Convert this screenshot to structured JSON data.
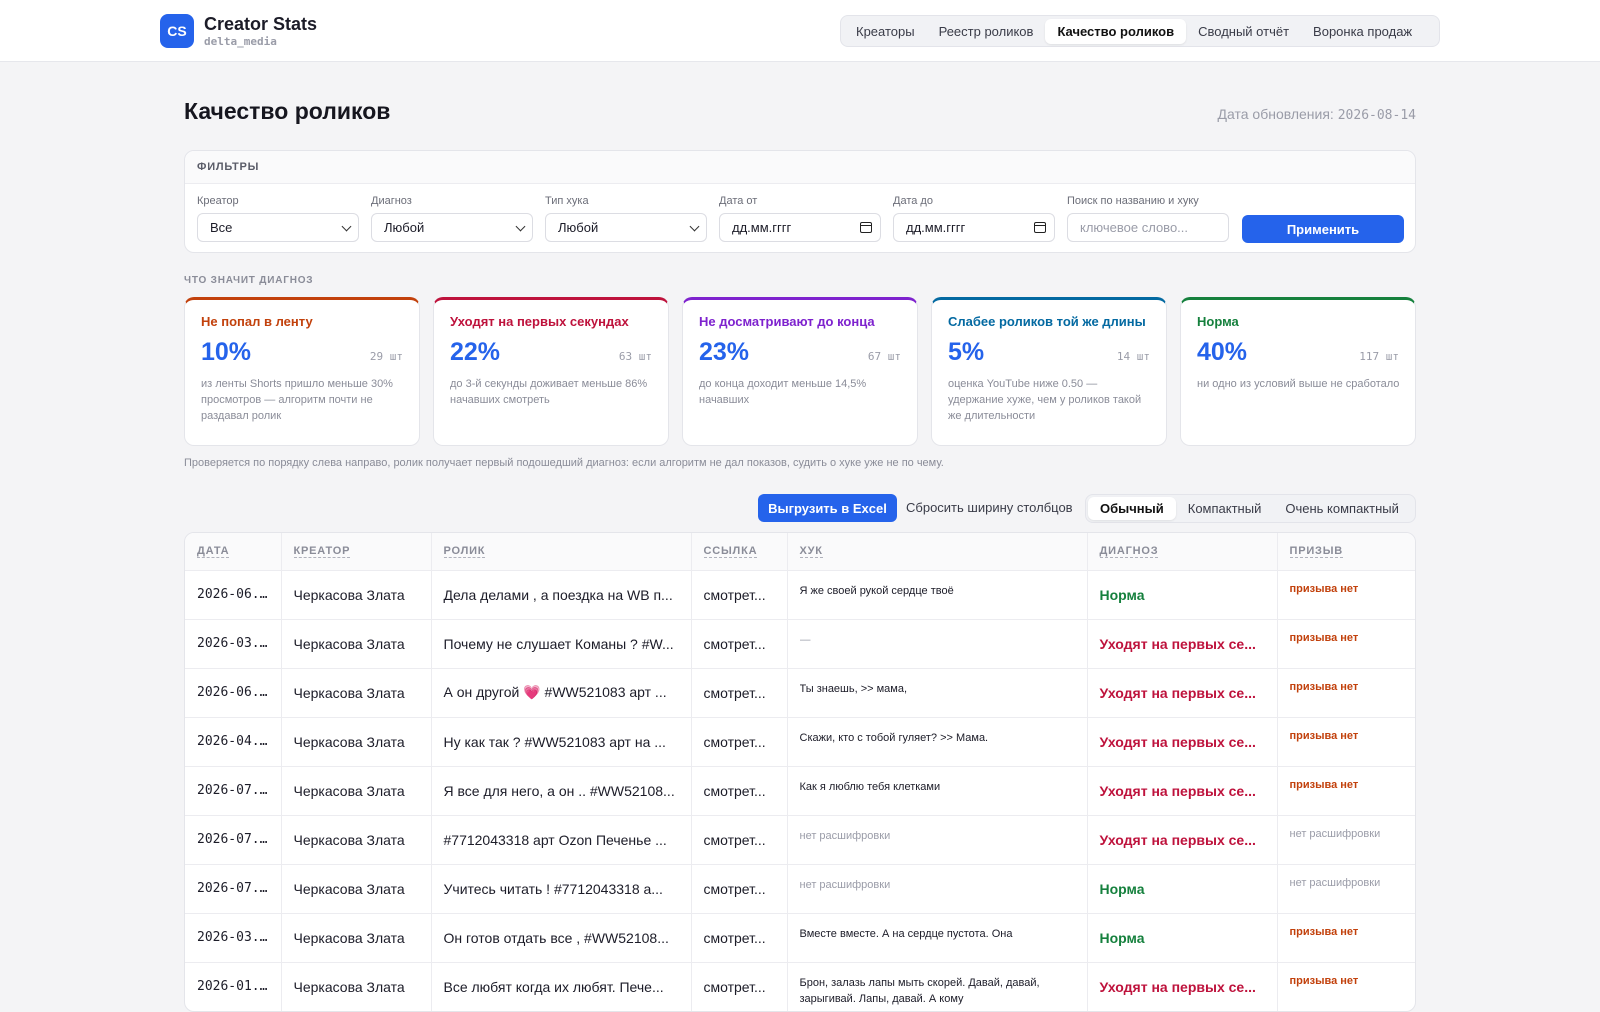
{
  "brand": {
    "logo": "CS",
    "title": "Creator Stats",
    "subtitle": "delta_media"
  },
  "nav": [
    "Креаторы",
    "Реестр роликов",
    "Качество роликов",
    "Сводный отчёт",
    "Воронка продаж"
  ],
  "nav_active": 2,
  "page": {
    "title": "Качество роликов",
    "update_label": "Дата обновления:",
    "update_date": "2026-08-14"
  },
  "filters": {
    "header": "ФИЛЬТРЫ",
    "creator": {
      "label": "Креатор",
      "value": "Все"
    },
    "diagnosis": {
      "label": "Диагноз",
      "value": "Любой"
    },
    "hook_type": {
      "label": "Тип хука",
      "value": "Любой"
    },
    "date_from": {
      "label": "Дата от",
      "value": "дд.мм.гггг"
    },
    "date_to": {
      "label": "Дата до",
      "value": "дд.мм.гггг"
    },
    "search": {
      "label": "Поиск по названию и хуку",
      "placeholder": "ключевое слово..."
    },
    "apply": "Применить"
  },
  "diagnosis_section": {
    "header": "ЧТО ЗНАЧИТ ДИАГНОЗ",
    "note": "Проверяется по порядку слева направо, ролик получает первый подошедший диагноз: если алгоритм не дал показов, судить о хуке уже не по чему.",
    "cards": [
      {
        "title": "Не попал в ленту",
        "percent": "10%",
        "count": "29 шт",
        "description": "из ленты Shorts пришло меньше 30% просмотров — алгоритм почти не раздавал ролик",
        "color": "#c2410c"
      },
      {
        "title": "Уходят на первых секундах",
        "percent": "22%",
        "count": "63 шт",
        "description": "до 3-й секунды доживает меньше 86% начавших смотреть",
        "color": "#be123c"
      },
      {
        "title": "Не досматривают до конца",
        "percent": "23%",
        "count": "67 шт",
        "description": "до конца доходит меньше 14,5% начавших",
        "color": "#7e22ce"
      },
      {
        "title": "Слабее роликов той же длины",
        "percent": "5%",
        "count": "14 шт",
        "description": "оценка YouTube ниже 0.50 — удержание хуже, чем у роликов такой же длительности",
        "color": "#0369a1"
      },
      {
        "title": "Норма",
        "percent": "40%",
        "count": "117 шт",
        "description": "ни одно из условий выше не сработало",
        "color": "#15803d"
      }
    ]
  },
  "toolbar": {
    "export": "Выгрузить в Excel",
    "reset": "Сбросить ширину столбцов",
    "density": [
      "Обычный",
      "Компактный",
      "Очень компактный"
    ],
    "density_active": 0
  },
  "table": {
    "columns": [
      "ДАТА",
      "КРЕАТОР",
      "РОЛИК",
      "ССЫЛКА",
      "ХУК",
      "ДИАГНОЗ",
      "ПРИЗЫВ"
    ],
    "rows": [
      {
        "date": "2026-06...",
        "creator": "Черкасова Злата",
        "video": "Дела делами , а поездка на WB п...",
        "link": "смотрет...",
        "hook": "Я же своей рукой сердце твоё",
        "diag": "Норма",
        "diag_color": "#15803d",
        "cta": "призыва нет",
        "hook_muted": false,
        "cta_muted": false
      },
      {
        "date": "2026-03...",
        "creator": "Черкасова Злата",
        "video": "Почему не слушает Команы ? #W...",
        "link": "смотрет...",
        "hook": "—",
        "diag": "Уходят на первых се...",
        "diag_color": "#be123c",
        "cta": "призыва нет",
        "hook_muted": true,
        "cta_muted": false
      },
      {
        "date": "2026-06...",
        "creator": "Черкасова Злата",
        "video": "А он другой 💗 #WW521083 арт ...",
        "link": "смотрет...",
        "hook": "Ты знаешь, >> мама,",
        "diag": "Уходят на первых се...",
        "diag_color": "#be123c",
        "cta": "призыва нет",
        "hook_muted": false,
        "cta_muted": false
      },
      {
        "date": "2026-04...",
        "creator": "Черкасова Злата",
        "video": "Ну как так ? #WW521083 арт на ...",
        "link": "смотрет...",
        "hook": "Скажи, кто с тобой гуляет? >> Мама.",
        "diag": "Уходят на первых се...",
        "diag_color": "#be123c",
        "cta": "призыва нет",
        "hook_muted": false,
        "cta_muted": false
      },
      {
        "date": "2026-07...",
        "creator": "Черкасова Злата",
        "video": "Я все для него, а он .. #WW52108...",
        "link": "смотрет...",
        "hook": "Как я люблю тебя клетками",
        "diag": "Уходят на первых се...",
        "diag_color": "#be123c",
        "cta": "призыва нет",
        "hook_muted": false,
        "cta_muted": false
      },
      {
        "date": "2026-07...",
        "creator": "Черкасова Злата",
        "video": "#7712043318 арт Ozon Печенье ...",
        "link": "смотрет...",
        "hook": "нет расшифровки",
        "diag": "Уходят на первых се...",
        "diag_color": "#be123c",
        "cta": "нет расшифровки",
        "hook_muted": true,
        "cta_muted": true
      },
      {
        "date": "2026-07...",
        "creator": "Черкасова Злата",
        "video": "Учитесь читать ! #7712043318 а...",
        "link": "смотрет...",
        "hook": "нет расшифровки",
        "diag": "Норма",
        "diag_color": "#15803d",
        "cta": "нет расшифровки",
        "hook_muted": true,
        "cta_muted": true
      },
      {
        "date": "2026-03...",
        "creator": "Черкасова Злата",
        "video": "Он готов отдать все , #WW52108...",
        "link": "смотрет...",
        "hook": "Вместе вместе. А на сердце пустота. Она",
        "diag": "Норма",
        "diag_color": "#15803d",
        "cta": "призыва нет",
        "hook_muted": false,
        "cta_muted": false
      },
      {
        "date": "2026-01...",
        "creator": "Черкасова Злата",
        "video": "Все любят когда их любят. Пече...",
        "link": "смотрет...",
        "hook": "Брон, залазь лапы мыть скорей. Давай, давай, зарыгивай. Лапы, давай. А кому",
        "diag": "Уходят на первых се...",
        "diag_color": "#be123c",
        "cta": "призыва нет",
        "hook_muted": false,
        "cta_muted": false
      }
    ]
  }
}
